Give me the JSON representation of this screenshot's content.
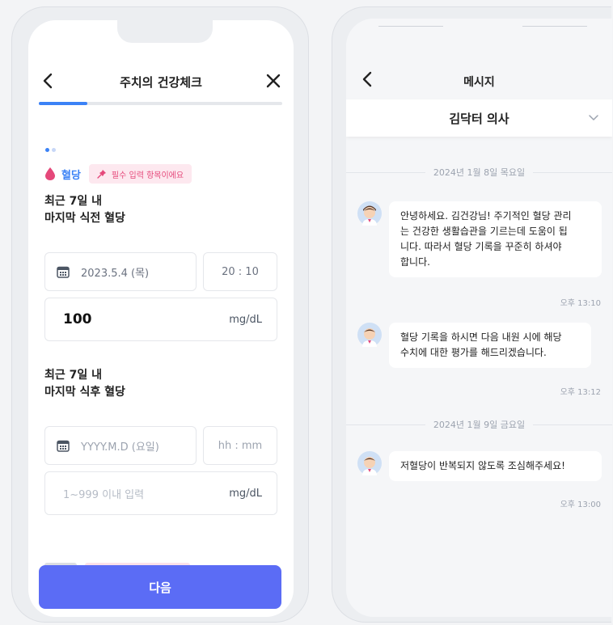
{
  "health_check": {
    "title": "주치의 건강체크",
    "progress": 0.2,
    "step_dots": 2,
    "category_label": "혈당",
    "required_badge": "필수 입력 항목이에요",
    "sections": [
      {
        "title_line1": "최근 7일 내",
        "title_line2": "마지막 식전 혈당",
        "date": "2023.5.4 (목)",
        "time": "20 : 10",
        "value": "100",
        "unit": "mg/dL"
      },
      {
        "title_line1": "최근 7일 내",
        "title_line2": "마지막 식후 혈당",
        "date_placeholder": "YYYY.M.D (요일)",
        "time_placeholder": "hh : mm",
        "value_placeholder": "1~999 이내 입력",
        "unit": "mg/dL"
      }
    ],
    "next_button": "다음",
    "colors": {
      "accent": "#3b82f6",
      "button": "#5b6cf5",
      "badge_bg": "#fde8ef",
      "badge_text": "#e5487a",
      "drop": "#e5487a"
    }
  },
  "messages": {
    "title": "메시지",
    "doctor_name": "김닥터 의사",
    "groups": [
      {
        "date": "2024년 1월 8일 목요일",
        "items": [
          {
            "lines": [
              "안녕하세요. 김건강님! 주기적인 혈당 관리",
              "는 건강한 생활습관을 기르는데 도움이 됩",
              "니다. 따라서 혈당 기록을 꾸준히 하셔야",
              "합니다."
            ],
            "time": "오후 13:10"
          },
          {
            "lines": [
              "혈당 기록을 하시면 다음 내원 시에 해당",
              "수치에 대한 평가를 해드리겠습니다."
            ],
            "time": "오후 13:12"
          }
        ]
      },
      {
        "date": "2024년 1월 9일 금요일",
        "items": [
          {
            "lines": [
              "저혈당이 반복되지 않도록 조심해주세요!"
            ],
            "time": "오후 13:00"
          }
        ]
      }
    ]
  }
}
